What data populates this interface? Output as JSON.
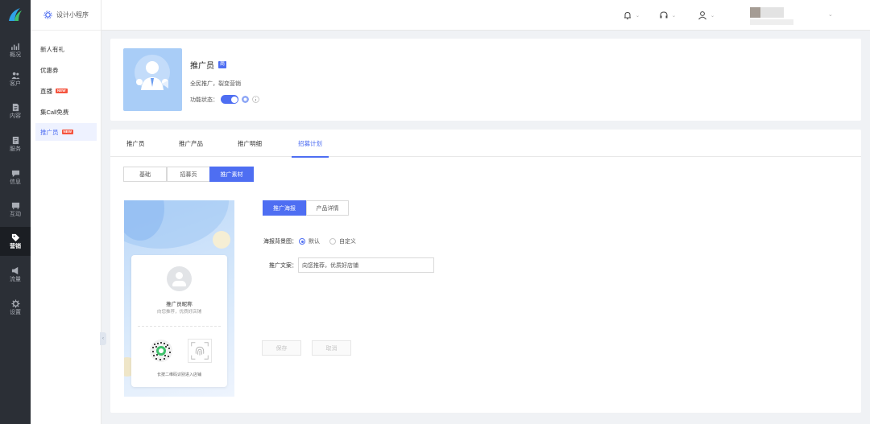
{
  "app": {
    "program_label": "设计小程序"
  },
  "rail": {
    "items": [
      {
        "label": "概况",
        "icon": "chart-icon"
      },
      {
        "label": "客户",
        "icon": "users-icon"
      },
      {
        "label": "内容",
        "icon": "document-icon"
      },
      {
        "label": "服务",
        "icon": "service-icon"
      },
      {
        "label": "信息",
        "icon": "message-icon"
      },
      {
        "label": "互动",
        "icon": "interact-icon"
      },
      {
        "label": "营销",
        "icon": "tag-icon",
        "active": true
      },
      {
        "label": "流量",
        "icon": "megaphone-icon"
      },
      {
        "label": "设置",
        "icon": "gear-icon"
      }
    ]
  },
  "subnav": {
    "items": [
      {
        "label": "新人有礼"
      },
      {
        "label": "优惠券"
      },
      {
        "label": "直播",
        "badge": "NEW"
      },
      {
        "label": "集Call免费"
      },
      {
        "label": "推广员",
        "badge": "NEW",
        "active": true
      }
    ],
    "collapse_icon": "‹"
  },
  "topbar": {
    "icons": [
      "bell-icon",
      "headset-icon",
      "user-icon"
    ],
    "caret": "⌄"
  },
  "profile": {
    "title": "推广员",
    "tag": "商",
    "description": "全民推广，裂变营销",
    "status_label": "功能状态：",
    "enabled": true
  },
  "tabs": [
    {
      "label": "推广员"
    },
    {
      "label": "推广产品"
    },
    {
      "label": "推广明细"
    },
    {
      "label": "招募计划",
      "active": true
    }
  ],
  "sub_tabs": [
    {
      "label": "基础"
    },
    {
      "label": "招募页"
    },
    {
      "label": "推广素材",
      "active": true
    }
  ],
  "poster": {
    "name": "推广员昵称",
    "slogan": "向您推荐，优质好店铺",
    "hint": "长按二维码识别进入店铺"
  },
  "form": {
    "tabs": [
      {
        "label": "推广海报",
        "active": true
      },
      {
        "label": "产品详情"
      }
    ],
    "bg_label": "海报背景图：",
    "bg_options": [
      {
        "label": "默认",
        "selected": true
      },
      {
        "label": "自定义"
      }
    ],
    "copy_label": "推广文案：",
    "copy_value": "向您推荐，优质好店铺",
    "save_label": "保存",
    "cancel_label": "取消"
  },
  "colors": {
    "primary": "#4e6ef2",
    "rail": "#2b2f36",
    "badge": "#f5533d"
  }
}
